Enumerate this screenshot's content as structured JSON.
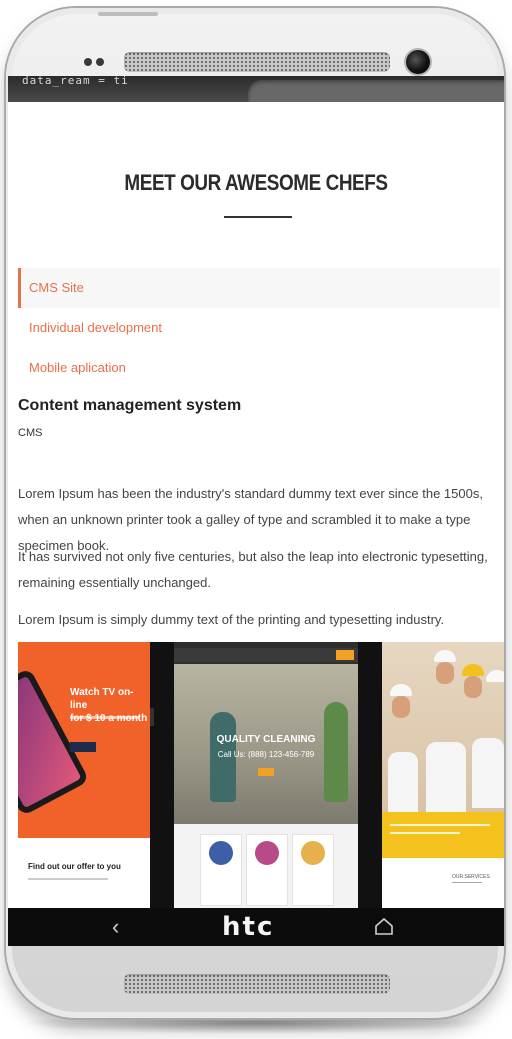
{
  "device": {
    "brand": "htc",
    "nav_back_icon": "back-chevron-icon",
    "nav_home_icon": "home-icon"
  },
  "hero": {
    "code_text": "data_ream = ti"
  },
  "section": {
    "title": "MEET OUR AWESOME CHEFS"
  },
  "tabs": [
    {
      "label": "CMS Site",
      "active": true
    },
    {
      "label": "Individual development",
      "active": false
    },
    {
      "label": "Mobile aplication",
      "active": false
    }
  ],
  "content": {
    "heading": "Content management system",
    "subheading": "CMS",
    "paragraphs": [
      "Lorem Ipsum has been the industry's standard dummy text ever since the 1500s, when an unknown printer took a galley of type and scrambled it to make a type specimen book.",
      "It has survived not only five centuries, but also the leap into electronic typesetting, remaining essentially unchanged.",
      "Lorem Ipsum is simply dummy text of the printing and typesetting industry."
    ]
  },
  "gallery": {
    "shot1": {
      "promo_line1": "Watch TV on-line",
      "promo_line2": "for $ 10 a month",
      "find_text": "Find out our offer to you"
    },
    "shot2": {
      "headline": "QUALITY CLEANING",
      "phone": "Call Us: (888) 123-456-789"
    },
    "shot3": {
      "services": "OUR SERVICES"
    }
  },
  "colors": {
    "accent": "#e8704a",
    "heading": "#2b2b2b",
    "navbar": "#0c0c0c"
  }
}
